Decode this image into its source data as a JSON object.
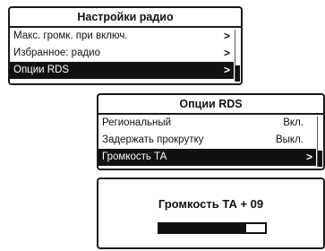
{
  "radio_settings": {
    "title": "Настройки радио",
    "items": [
      {
        "label": "Макс. громк. при включ.",
        "chevron": ">"
      },
      {
        "label": "Избранное: радио",
        "chevron": ">"
      },
      {
        "label": "Опции RDS",
        "chevron": ">"
      }
    ]
  },
  "rds_options": {
    "title": "Опции RDS",
    "items": [
      {
        "label": "Региональный",
        "value": "Вкл."
      },
      {
        "label": "Задержать прокрутку",
        "value": "Выкл."
      },
      {
        "label": "Громкость ТА",
        "chevron": ">"
      }
    ]
  },
  "ta_volume": {
    "label": "Громкость ТА + 09",
    "level_fraction": 0.82
  }
}
